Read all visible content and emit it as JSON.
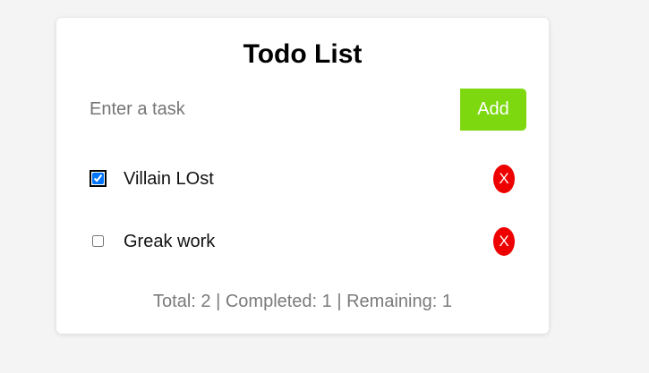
{
  "app": {
    "title": "Todo List"
  },
  "input": {
    "value": "",
    "placeholder": "Enter a task"
  },
  "add_button": {
    "label": "Add"
  },
  "todos": [
    {
      "text": "Villain LOst",
      "completed": true,
      "delete_label": "X"
    },
    {
      "text": "Greak work",
      "completed": false,
      "delete_label": "X"
    }
  ],
  "stats": {
    "text": "Total: 2 | Completed: 1 | Remaining: 1"
  },
  "colors": {
    "add_button": "#7ed80f",
    "delete_button": "#ee0000",
    "checkbox_checked": "#0a66d6"
  }
}
